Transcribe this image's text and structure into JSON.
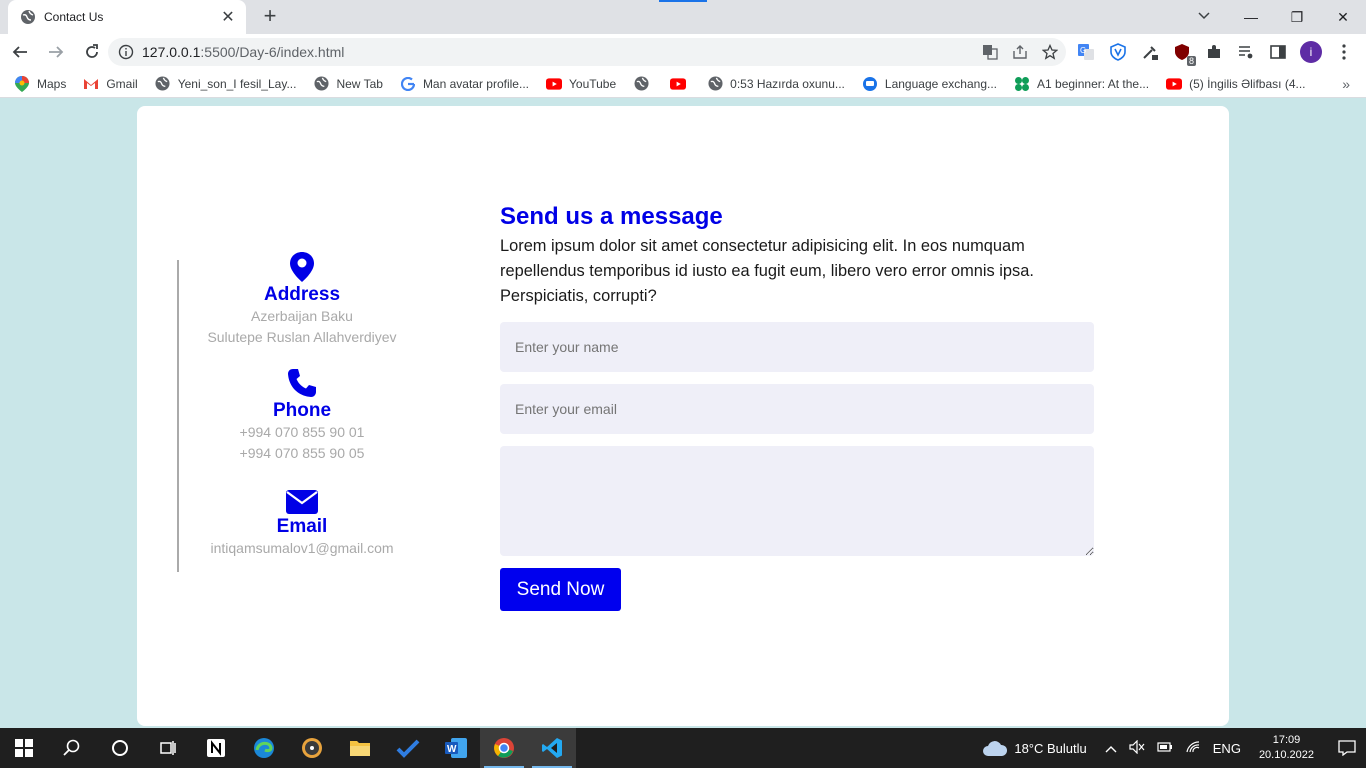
{
  "browser": {
    "tab_title": "Contact Us",
    "tab_close": "✕",
    "new_tab": "+",
    "url_host": "127.0.0.1",
    "url_rest": ":5500/Day-6/index.html",
    "avatar_letter": "i",
    "ext_badge": "8",
    "window_controls": {
      "minimize": "—",
      "restore": "❐",
      "close": "✕"
    }
  },
  "bookmarks": [
    {
      "label": "Maps",
      "icon": "maps-icon"
    },
    {
      "label": "Gmail",
      "icon": "gmail-icon"
    },
    {
      "label": "Yeni_son_I fesil_Lay...",
      "icon": "globe-icon"
    },
    {
      "label": "New Tab",
      "icon": "globe-icon"
    },
    {
      "label": "Man avatar profile...",
      "icon": "google-icon"
    },
    {
      "label": "YouTube",
      "icon": "youtube-icon"
    },
    {
      "label": "",
      "icon": "globe-icon"
    },
    {
      "label": "",
      "icon": "youtube-icon"
    },
    {
      "label": "0:53 Hazırda oxunu...",
      "icon": "globe-icon"
    },
    {
      "label": "Language exchang...",
      "icon": "chat-icon"
    },
    {
      "label": "A1 beginner: At the...",
      "icon": "clover-icon"
    },
    {
      "label": "(5) İngilis Əlifbası (4...",
      "icon": "youtube-icon"
    }
  ],
  "bookmarks_more": "»",
  "contact": {
    "address": {
      "title": "Address",
      "line1": "Azerbaijan Baku",
      "line2": "Sulutepe Ruslan Allahverdiyev"
    },
    "phone": {
      "title": "Phone",
      "line1": "+994 070 855 90 01",
      "line2": "+994 070 855 90 05"
    },
    "email": {
      "title": "Email",
      "line1": "intiqamsumalov1@gmail.com"
    }
  },
  "form": {
    "heading": "Send us a message",
    "description": "Lorem ipsum dolor sit amet consectetur adipisicing elit. In eos numquam repellendus temporibus id iusto ea fugit eum, libero vero error omnis ipsa. Perspiciatis, corrupti?",
    "name_placeholder": "Enter your name",
    "email_placeholder": "Enter your email",
    "message_value": "",
    "submit_label": "Send Now"
  },
  "colors": {
    "accent": "#0000e6",
    "page_bg": "#c9e6e8",
    "field_bg": "#efeff8"
  },
  "taskbar": {
    "weather": "18°C  Bulutlu",
    "language": "ENG",
    "time": "17:09",
    "date": "20.10.2022"
  }
}
